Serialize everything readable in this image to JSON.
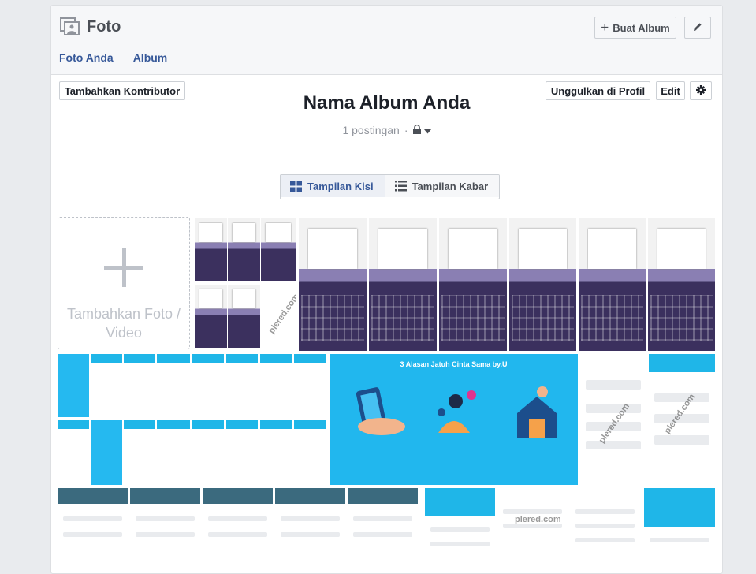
{
  "header": {
    "title": "Foto",
    "create_album_label": "Buat Album",
    "tabs": [
      {
        "label": "Foto Anda"
      },
      {
        "label": "Album"
      }
    ]
  },
  "album": {
    "add_contributor_label": "Tambahkan Kontributor",
    "upload_profile_label": "Unggulkan di Profil",
    "edit_label": "Edit",
    "title": "Nama Album Anda",
    "post_count": "1 postingan",
    "separator": "·",
    "view_toggle": {
      "grid_label": "Tampilan Kisi",
      "feed_label": "Tampilan Kabar"
    },
    "add_photo_label": "Tambahkan Foto / Video"
  },
  "watermark_text": "plered.com",
  "banner": {
    "title": "3 Alasan Jatuh Cinta Sama by.U"
  },
  "colors": {
    "link": "#365899",
    "accent_blue": "#21b7ee",
    "keyboard_purple": "#3b305e"
  }
}
